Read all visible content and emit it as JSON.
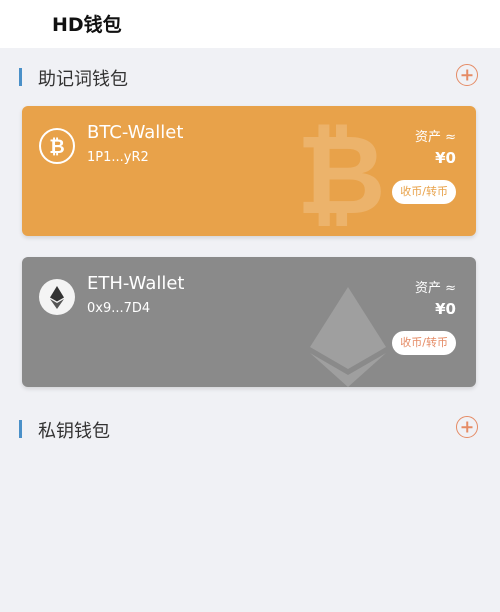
{
  "header": {
    "title": "HD钱包"
  },
  "sections": {
    "hd": {
      "label": "助记词钱包"
    },
    "private": {
      "label": "私钥钱包"
    }
  },
  "wallets": [
    {
      "name": "BTC-Wallet",
      "address": "1P1...yR2",
      "asset_label": "资产 ≈",
      "balance": "¥0",
      "action_label": "收币/转币",
      "color": "#e8a24a",
      "icon": "bitcoin-icon"
    },
    {
      "name": "ETH-Wallet",
      "address": "0x9...7D4",
      "asset_label": "资产 ≈",
      "balance": "¥0",
      "action_label": "收币/转币",
      "color": "#8a8a8a",
      "icon": "ethereum-icon"
    }
  ],
  "colors": {
    "accent": "#e58b65",
    "section_bar": "#4a90c8",
    "background": "#f0f1f5"
  }
}
